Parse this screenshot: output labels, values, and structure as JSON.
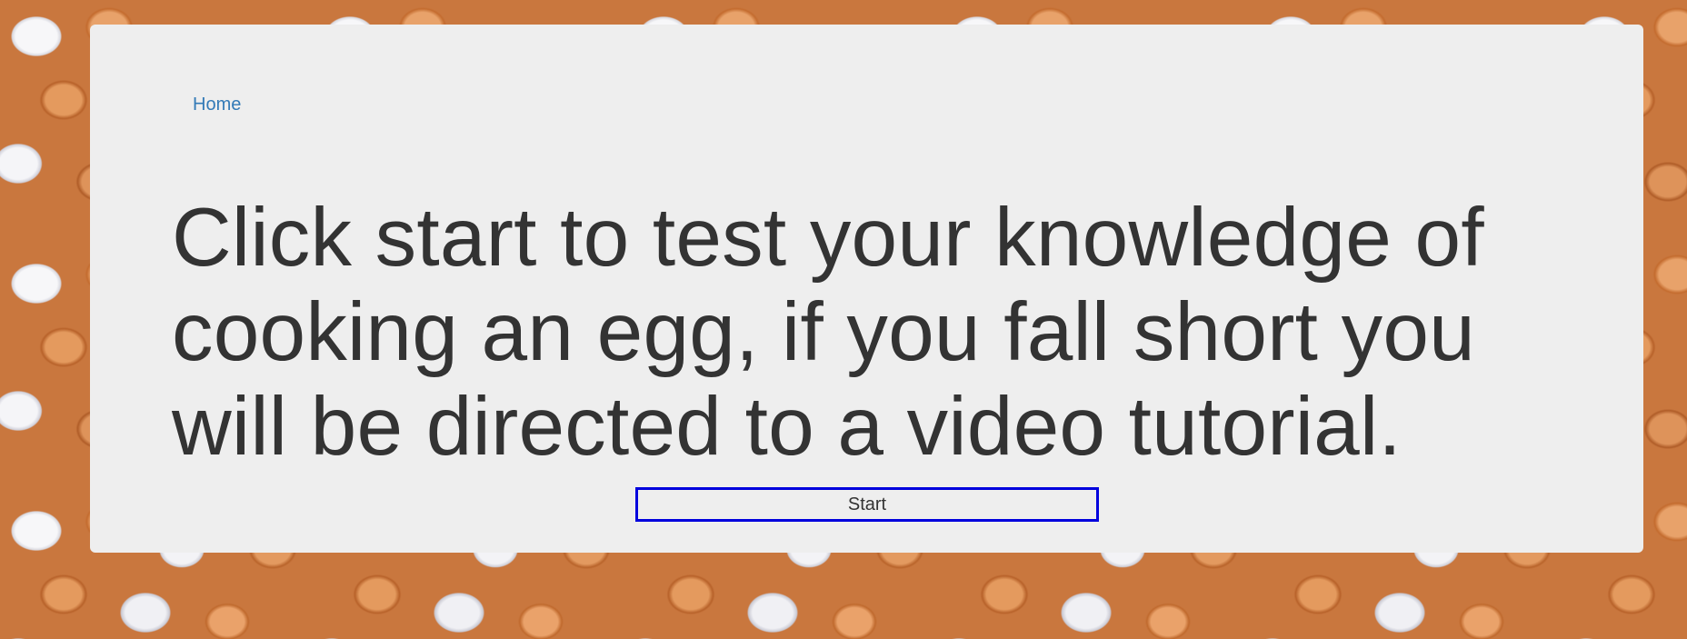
{
  "nav": {
    "home_label": "Home"
  },
  "main": {
    "headline": "Click start to test your knowledge of cooking an egg, if you fall short you will be directed to a video tutorial.",
    "start_button_label": "Start"
  },
  "background": {
    "image_description": "egg-pile-pattern"
  },
  "colors": {
    "panel_background": "#eeeeee",
    "link": "#337ab7",
    "text": "#333333",
    "button_border": "#0000dd"
  }
}
